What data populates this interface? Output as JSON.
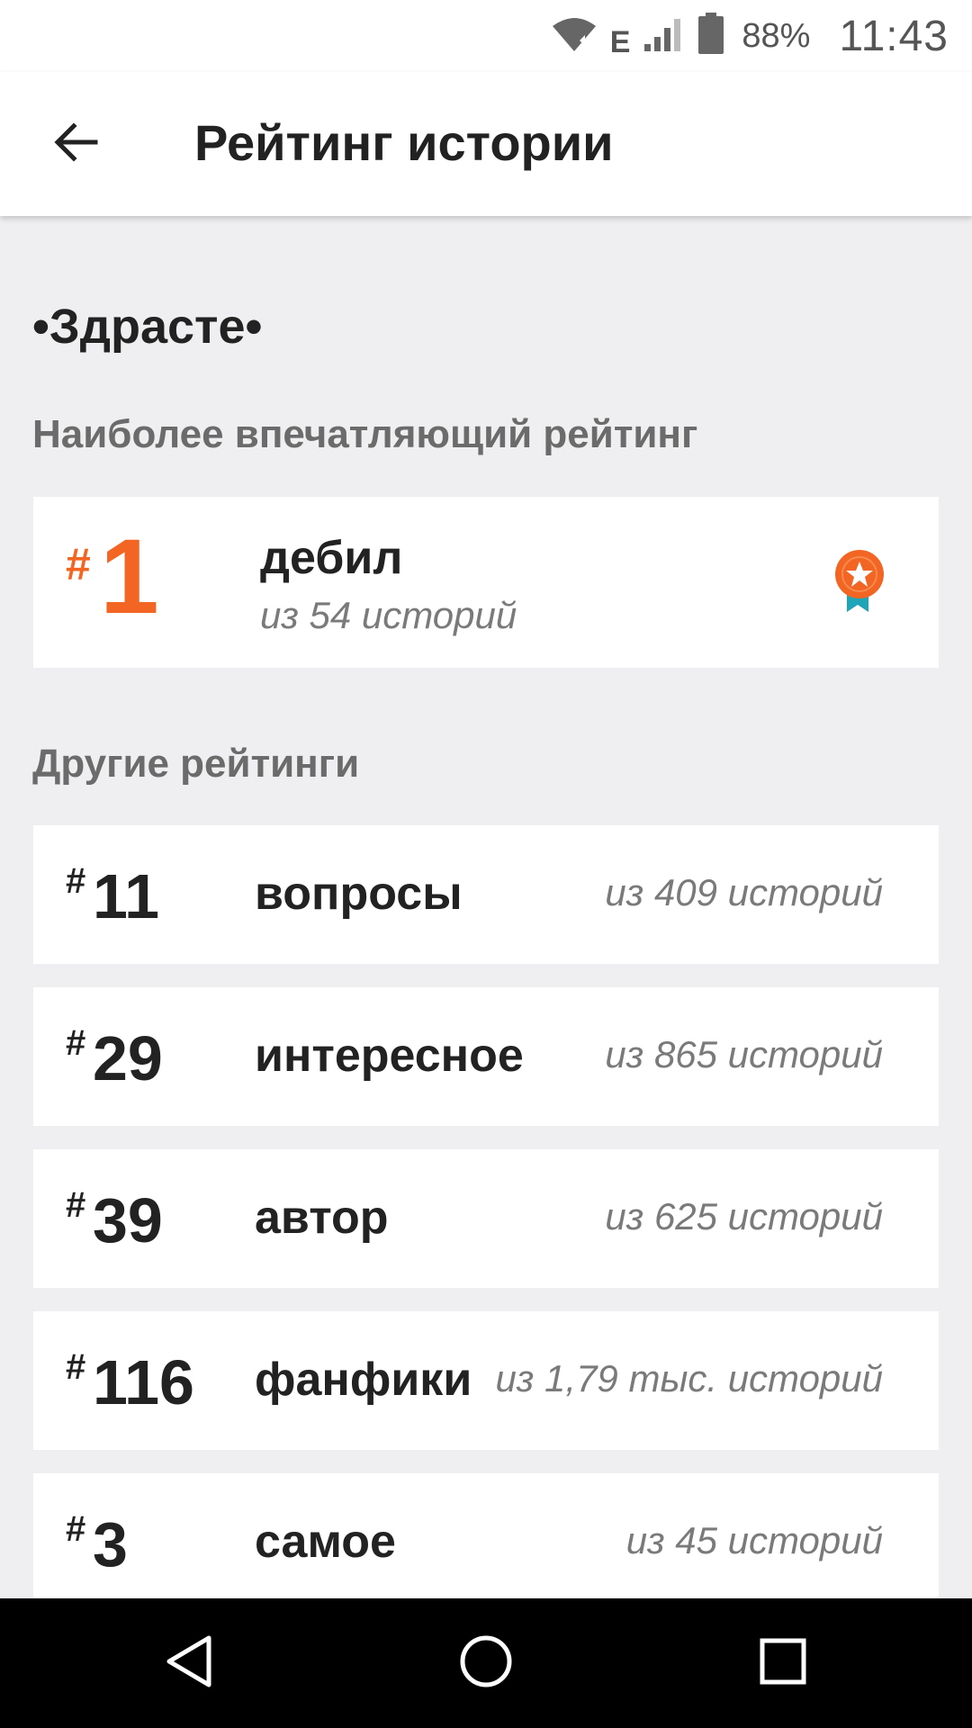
{
  "status_bar": {
    "network_type": "E",
    "battery_percent": "88%",
    "time": "11:43"
  },
  "app_bar": {
    "title": "Рейтинг истории",
    "back_icon": "arrow-left-icon"
  },
  "story": {
    "title": "•Здрасте•"
  },
  "best_ranking": {
    "header": "Наиболее впечатляющий рейтинг",
    "hash": "#",
    "rank": "1",
    "tag": "дебил",
    "subtitle": "из 54 историй",
    "badge_icon": "medal-star-icon",
    "accent_color": "#f26522",
    "ribbon_color": "#1fa5b8"
  },
  "other_rankings": {
    "header": "Другие рейтинги",
    "items": [
      {
        "hash": "#",
        "rank": "11",
        "tag": "вопросы",
        "count": "из 409 историй"
      },
      {
        "hash": "#",
        "rank": "29",
        "tag": "интересное",
        "count": "из 865 историй"
      },
      {
        "hash": "#",
        "rank": "39",
        "tag": "автор",
        "count": "из 625 историй"
      },
      {
        "hash": "#",
        "rank": "116",
        "tag": "фанфики",
        "count": "из 1,79 тыс. историй"
      },
      {
        "hash": "#",
        "rank": "3",
        "tag": "самое",
        "count": "из 45 историй"
      }
    ]
  },
  "nav_bar": {
    "back_icon": "nav-back-triangle-icon",
    "home_icon": "nav-home-circle-icon",
    "recents_icon": "nav-recents-square-icon"
  }
}
